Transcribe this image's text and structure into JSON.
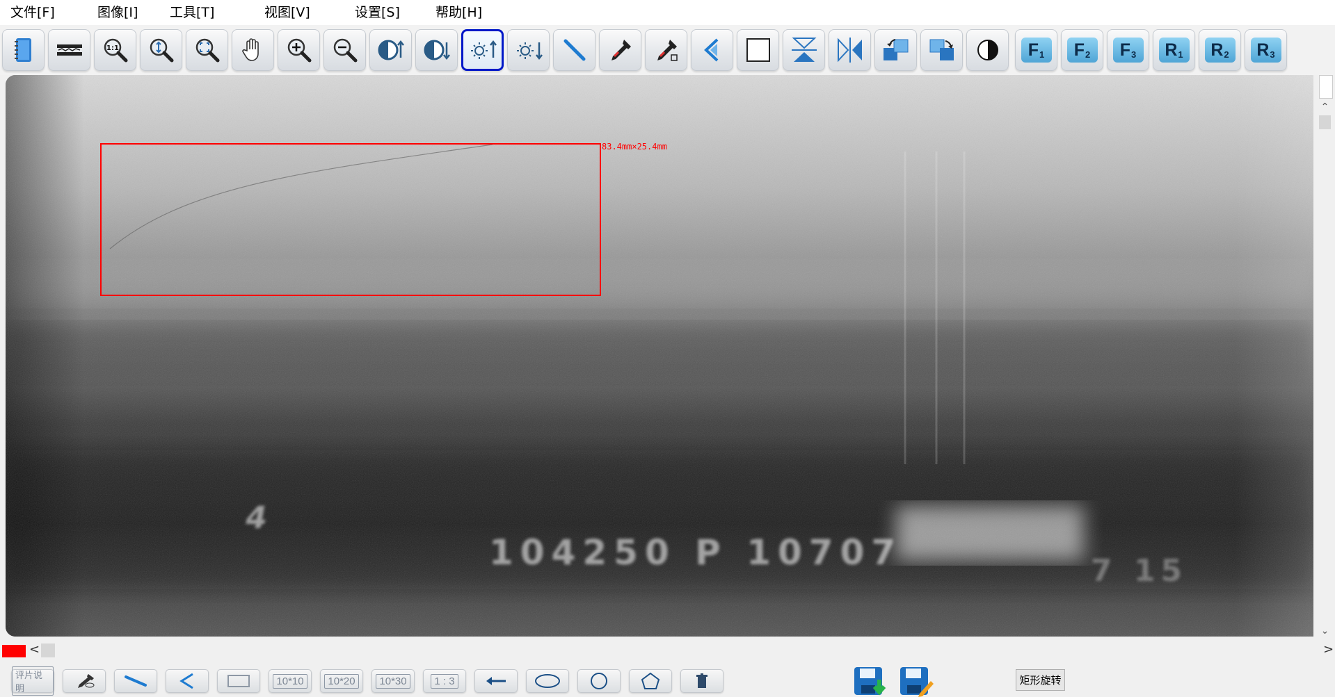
{
  "menu": {
    "items": [
      {
        "label": "文件[F]"
      },
      {
        "label": "图像[I]"
      },
      {
        "label": "工具[T]"
      },
      {
        "label": "视图[V]"
      },
      {
        "label": "设置[S]"
      },
      {
        "label": "帮助[H]"
      }
    ]
  },
  "toolbar": {
    "icons": [
      "notebook-icon",
      "line-profile-icon",
      "zoom-1to1-icon",
      "zoom-fit-height-icon",
      "zoom-fit-all-icon",
      "pan-hand-icon",
      "zoom-in-icon",
      "zoom-out-icon",
      "contrast-up-icon",
      "contrast-down-icon",
      "brightness-up-icon",
      "brightness-down-icon",
      "measure-line-icon",
      "eyedropper-icon",
      "eyedropper-sample-icon",
      "angle-icon",
      "rectangle-icon",
      "flip-vertical-icon",
      "flip-horizontal-icon",
      "rotate-left-icon",
      "rotate-right-icon",
      "invert-icon"
    ],
    "active_tool": "brightness-up-icon",
    "function_keys": [
      {
        "letter": "F",
        "num": "1"
      },
      {
        "letter": "F",
        "num": "2"
      },
      {
        "letter": "F",
        "num": "3"
      },
      {
        "letter": "R",
        "num": "1"
      },
      {
        "letter": "R",
        "num": "2"
      },
      {
        "letter": "R",
        "num": "3"
      }
    ]
  },
  "viewport": {
    "roi_label": "83.4mm×25.4mm",
    "film_marker": "4",
    "film_code": "104250 P 10707",
    "film_code_end": "7 15",
    "roi_color": "#ff0000"
  },
  "status": {
    "current_color": "#ff0000",
    "scroll_left_arrow": "<",
    "scroll_right_arrow": ">"
  },
  "bottom": {
    "film_note_label": "评片说明",
    "grid_10x10": "10*10",
    "grid_10x20": "10*20",
    "grid_10x30": "10*30",
    "ratio_1_3": "1 : 3",
    "rotate_rect_label": "矩形旋转"
  }
}
